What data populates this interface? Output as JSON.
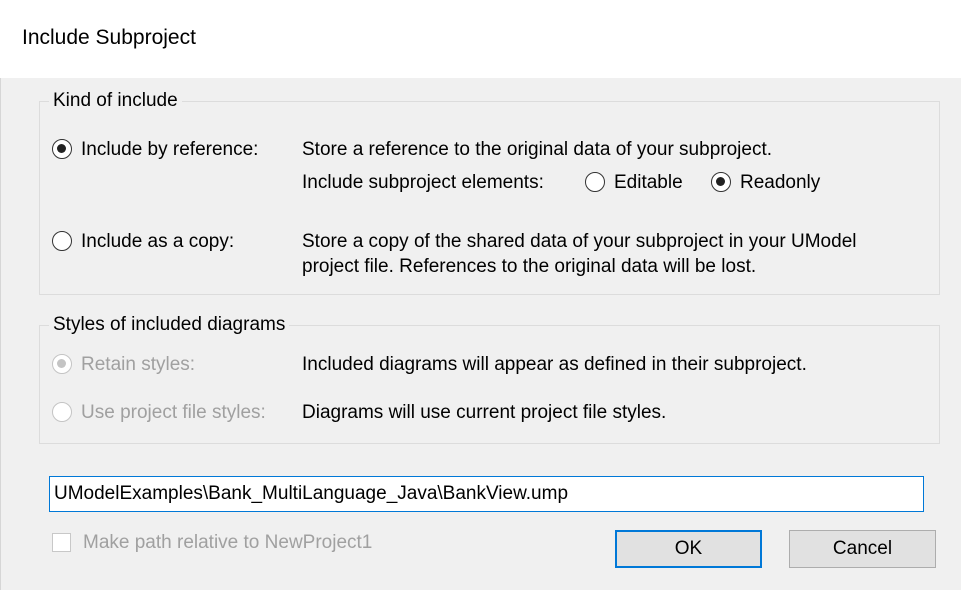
{
  "window": {
    "title": "Include Subproject"
  },
  "kind_group": {
    "legend": "Kind of include",
    "by_reference": {
      "label": "Include by reference:",
      "checked": true,
      "description": "Store a reference to the original data of your subproject.",
      "elements_label": "Include subproject elements:",
      "editable_label": "Editable",
      "readonly_label": "Readonly",
      "selected": "Readonly"
    },
    "as_copy": {
      "label": "Include as a copy:",
      "checked": false,
      "description_line1": "Store a copy of the shared data of your subproject in your UModel",
      "description_line2": "project file. References to the original data will be lost."
    }
  },
  "styles_group": {
    "legend": "Styles of included diagrams",
    "retain": {
      "label": "Retain styles:",
      "checked": true,
      "enabled": false,
      "description": "Included diagrams will appear as defined in their subproject."
    },
    "project": {
      "label": "Use project file styles:",
      "checked": false,
      "enabled": false,
      "description": "Diagrams will use current project file styles."
    }
  },
  "path": {
    "value": "UModelExamples\\Bank_MultiLanguage_Java\\BankView.ump"
  },
  "relative": {
    "label": "Make path relative to NewProject1",
    "checked": false,
    "enabled": false
  },
  "buttons": {
    "ok": "OK",
    "cancel": "Cancel"
  }
}
